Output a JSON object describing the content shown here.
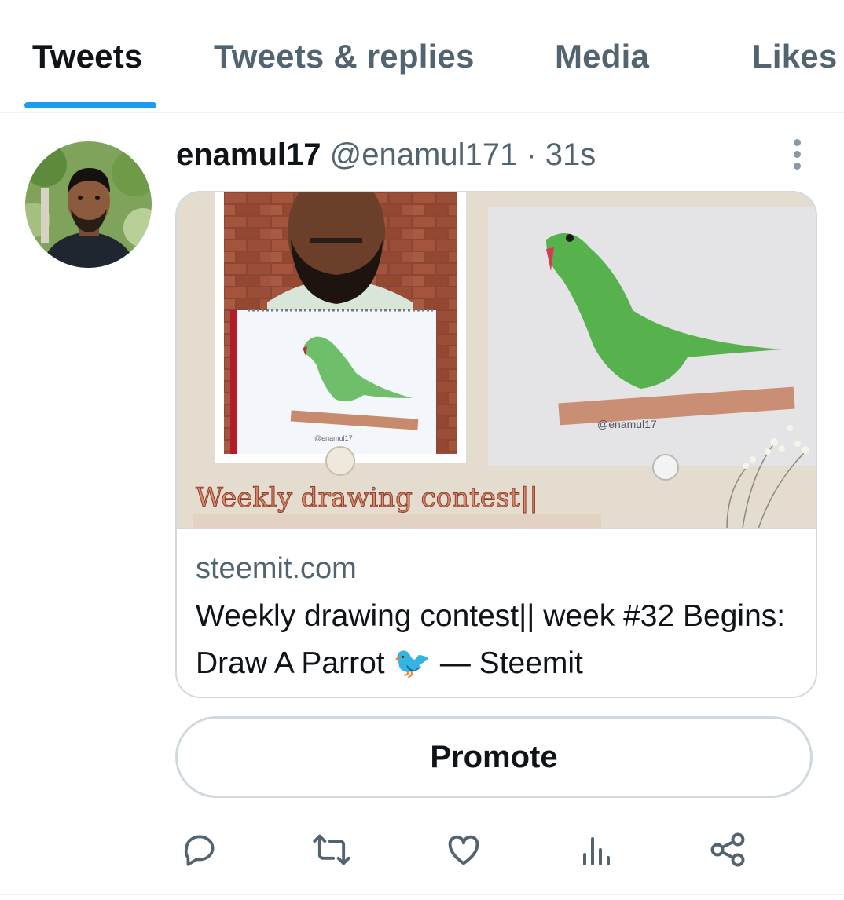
{
  "tabs": [
    {
      "label": "Tweets",
      "active": true
    },
    {
      "label": "Tweets & replies",
      "active": false
    },
    {
      "label": "Media",
      "active": false
    },
    {
      "label": "Likes",
      "active": false
    }
  ],
  "tweet": {
    "author_name": "enamul17",
    "handle": "@enamul171",
    "separator": "·",
    "time": "31s",
    "card": {
      "image_caption": "Weekly drawing contest||",
      "signature_left": "@enamul17",
      "signature_right": "@enamul17",
      "domain": "steemit.com",
      "title": "Weekly drawing contest|| week #32 Begins: Draw A Parrot 🐦 — Steemit"
    }
  },
  "promote_label": "Promote",
  "actions": [
    "reply-icon",
    "retweet-icon",
    "like-icon",
    "analytics-icon",
    "share-icon"
  ],
  "colors": {
    "accent": "#1d9bf0",
    "text_primary": "#0f1419",
    "text_secondary": "#536471",
    "border": "#cfd9de"
  }
}
